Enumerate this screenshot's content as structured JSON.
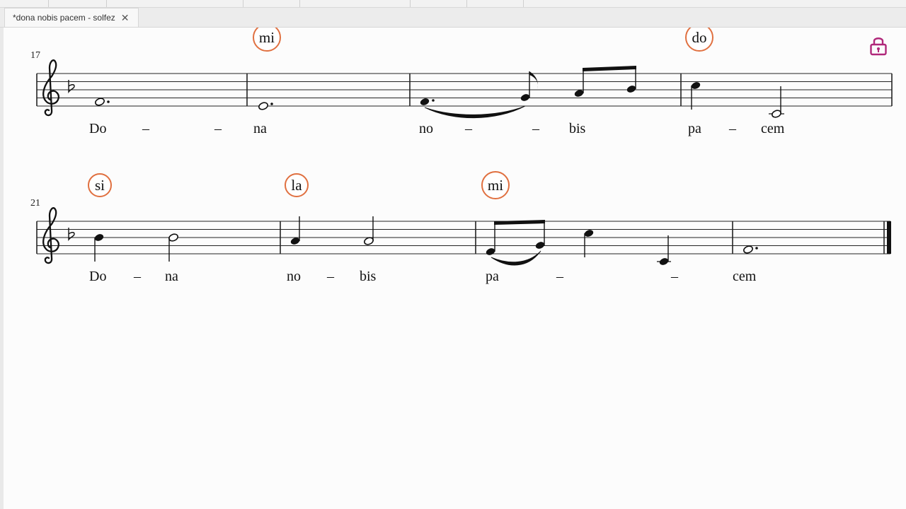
{
  "window": {
    "tab_title": "*dona nobis pacem - solfez",
    "close_glyph": "✕"
  },
  "icons": {
    "lock": "lock-icon",
    "close": "close-icon"
  },
  "colors": {
    "solfege_circle": "#e07040",
    "lock": "#b0287a"
  },
  "systems": [
    {
      "measure_number": "17",
      "lyrics": [
        "Do",
        "na",
        "no",
        "bis",
        "pa",
        "cem"
      ],
      "hyphens": [
        "–",
        "–",
        "–",
        "–",
        "–"
      ],
      "solfege": [
        "mi",
        "do"
      ]
    },
    {
      "measure_number": "21",
      "lyrics": [
        "Do",
        "na",
        "no",
        "bis",
        "pa",
        "cem"
      ],
      "hyphens": [
        "–",
        "–",
        "–",
        "–"
      ],
      "solfege": [
        "si",
        "la",
        "mi"
      ]
    }
  ]
}
